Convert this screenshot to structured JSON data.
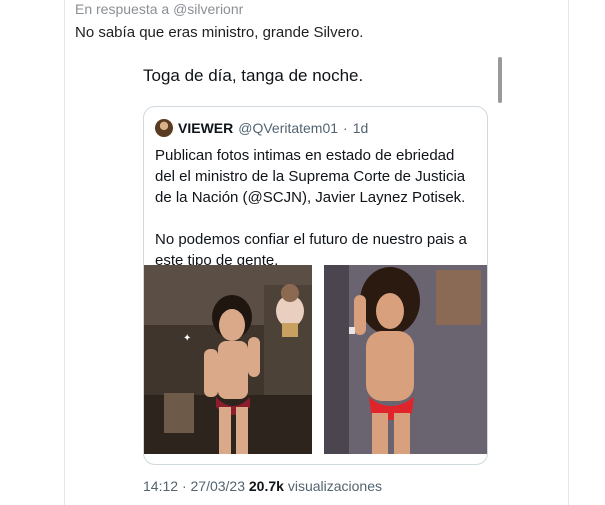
{
  "reply_context": {
    "prefix": "En respuesta a",
    "handle": "@silverionr"
  },
  "reply": {
    "text": "No sabía que eras ministro, grande Silvero."
  },
  "post": {
    "text": "Toga de día, tanga de noche."
  },
  "quote": {
    "name": "VIEWER",
    "handle": "@QVeritatem01",
    "separator": "·",
    "time": "1d",
    "paragraph1": "Publican fotos intimas en estado de ebriedad del el ministro de la Suprema Corte de Justicia de la Nación (@SCJN), Javier Laynez Potisek.",
    "paragraph2": "No podemos confiar el futuro de nuestro pais a este tipo de gente."
  },
  "meta": {
    "time": "14:12",
    "dot": "·",
    "date": "27/03/23",
    "views_count": "20.7k",
    "views_label": "visualizaciones"
  },
  "icons": {
    "alt_badge": "sparkle-icon"
  },
  "colors": {
    "muted": "#536471",
    "border": "#cfd9de"
  }
}
